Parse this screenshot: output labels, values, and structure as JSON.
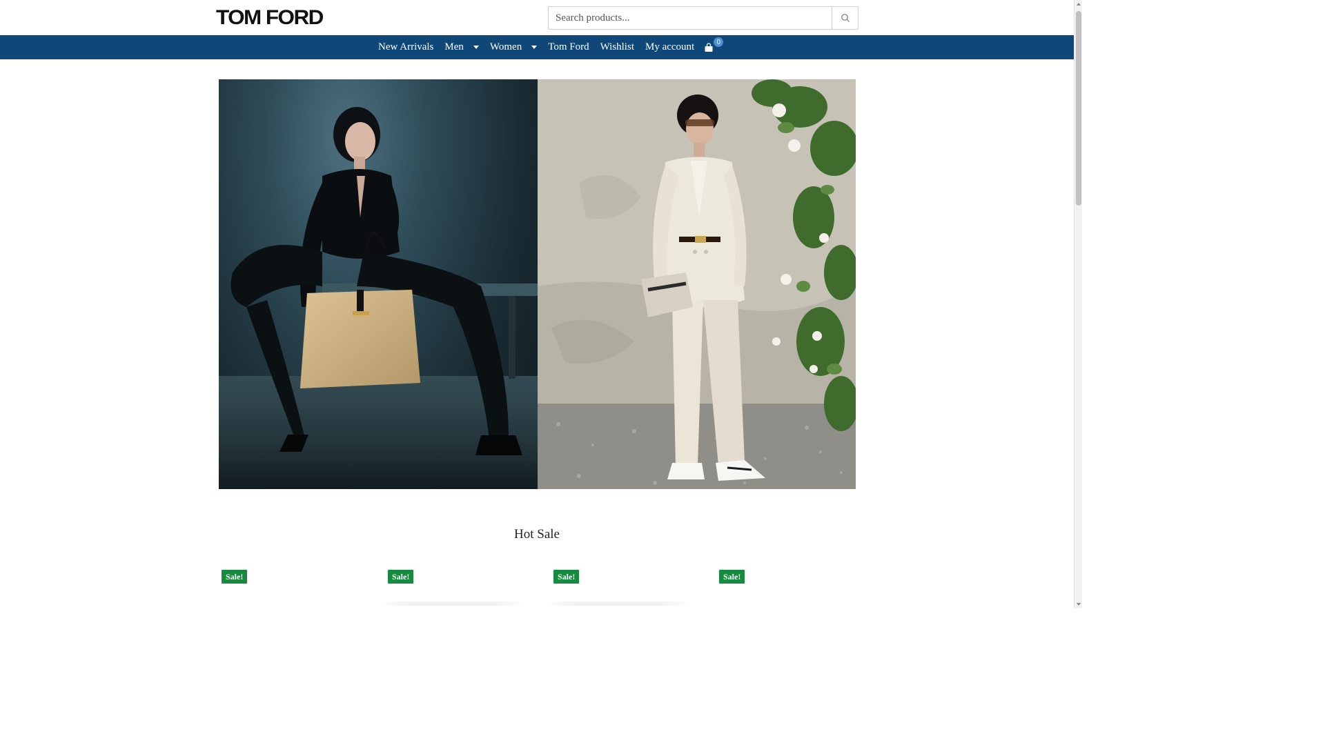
{
  "header": {
    "logo_text": "TOM FORD",
    "search": {
      "placeholder": "Search products...",
      "value": "",
      "button_icon": "search-icon"
    }
  },
  "nav": {
    "items": [
      {
        "label": "New Arrivals",
        "has_dropdown": false
      },
      {
        "label": "Men",
        "has_dropdown": true
      },
      {
        "label": "Women",
        "has_dropdown": true
      },
      {
        "label": "Tom Ford",
        "has_dropdown": false
      },
      {
        "label": "Wishlist",
        "has_dropdown": false
      },
      {
        "label": "My account",
        "has_dropdown": false
      }
    ],
    "cart": {
      "icon": "shopping-bag-icon",
      "count": "0"
    }
  },
  "hero": {
    "left_image": "woman-seated-with-tote-bag-photo",
    "right_image": "man-in-white-suit-by-wall-photo"
  },
  "main": {
    "section_title": "Hot Sale",
    "products": [
      {
        "badge": "Sale!"
      },
      {
        "badge": "Sale!"
      },
      {
        "badge": "Sale!"
      },
      {
        "badge": "Sale!"
      }
    ]
  },
  "colors": {
    "nav_background": "#0e4778",
    "sale_badge": "#168a3f",
    "cart_count": "#4a8fd4"
  }
}
